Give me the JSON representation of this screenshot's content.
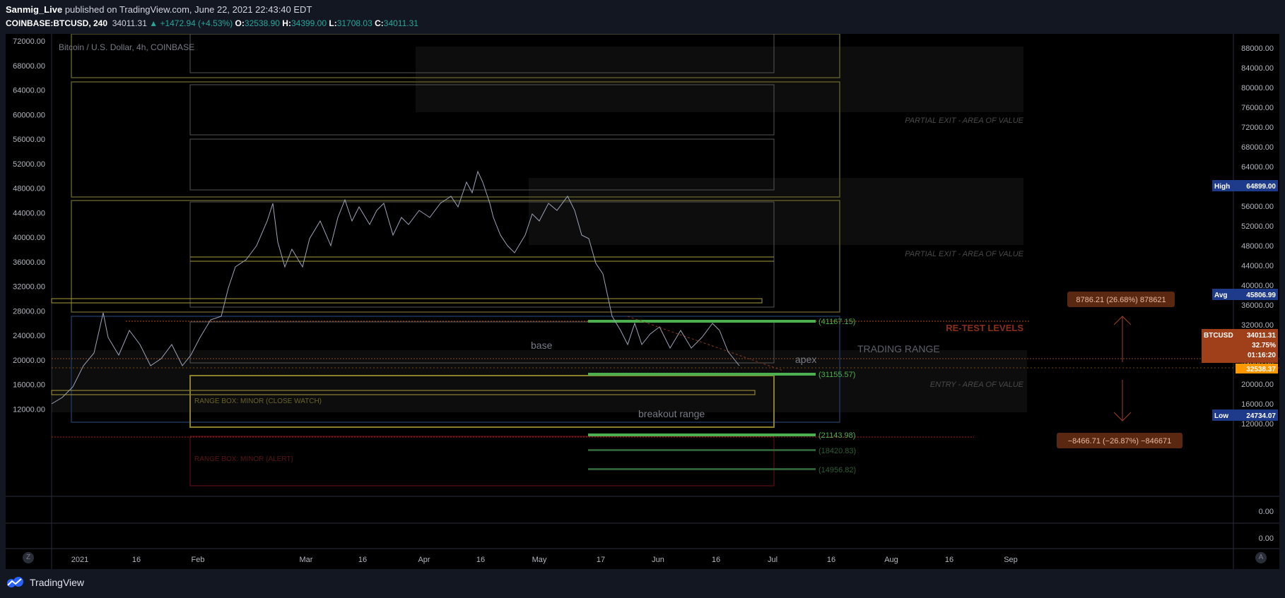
{
  "header": {
    "publisher": "Sanmig_Live",
    "published_text": "published on TradingView.com, June 22, 2021 22:43:40 EDT",
    "symbol": "COINBASE:BTCUSD, 240",
    "last": "34011.31",
    "change": "+1472.94 (+4.53%)",
    "o_label": "O:",
    "o": "32538.90",
    "h_label": "H:",
    "h": "34399.00",
    "l_label": "L:",
    "l": "31708.03",
    "c_label": "C:",
    "c": "34011.31"
  },
  "chart": {
    "title": "Bitcoin / U.S. Dollar, 4h, COINBASE",
    "left_axis": [
      "72000.00",
      "68000.00",
      "64000.00",
      "60000.00",
      "56000.00",
      "52000.00",
      "48000.00",
      "44000.00",
      "40000.00",
      "36000.00",
      "32000.00",
      "28000.00",
      "24000.00",
      "20000.00",
      "16000.00",
      "12000.00"
    ],
    "right_axis": [
      "88000.00",
      "84000.00",
      "80000.00",
      "76000.00",
      "72000.00",
      "68000.00",
      "64000.00",
      "60000.00",
      "56000.00",
      "52000.00",
      "48000.00",
      "44000.00",
      "40000.00",
      "36000.00",
      "32000.00",
      "28000.00",
      "24000.00",
      "20000.00",
      "16000.00",
      "12000.00"
    ],
    "sub_axis": [
      "0.00",
      "0.00"
    ],
    "x_axis": [
      "2021",
      "16",
      "Feb",
      "Mar",
      "16",
      "Apr",
      "16",
      "May",
      "17",
      "Jun",
      "16",
      "Jul",
      "16",
      "Aug",
      "16",
      "Sep"
    ],
    "annotations": {
      "partial_exit_1": "PARTIAL EXIT - AREA OF VALUE",
      "partial_exit_2": "PARTIAL EXIT - AREA OF VALUE",
      "retest": "RE-TEST LEVELS",
      "trading_range": "TRADING RANGE",
      "entry": "ENTRY - AREA OF VALUE",
      "base": "base",
      "apex": "apex",
      "breakout": "breakout range",
      "range_box_minor_watch": "RANGE BOX: MINOR  (CLOSE WATCH)",
      "range_box_minor_alert": "RANGE BOX: MINOR (ALERT)",
      "level_41167": "(41167.15)",
      "level_31155": "(31155.57)",
      "level_21143": "(21143.98)",
      "level_18420": "(18420.83)",
      "level_14956": "(14956.82)",
      "measure_up": "8786.21 (26.68%) 878621",
      "measure_down": "−8466.71 (−26.87%) −846671"
    },
    "badges": {
      "high_label": "High",
      "high_value": "64899.00",
      "avg_label": "Avg",
      "avg_value": "45806.99",
      "btc_label": "BTCUSD",
      "btc_value": "34011.31",
      "btc_pct": "32.75%",
      "btc_time": "01:16:20",
      "open_value": "32538.37",
      "low_label": "Low",
      "low_value": "24734.07"
    },
    "colors": {
      "green": "#4caf50",
      "orange": "#ff9800",
      "red": "#b71c1c",
      "navy": "#1e3a8a"
    }
  },
  "buttons": {
    "zoom_left": "Z",
    "auto_right": "A"
  },
  "footer": {
    "brand": "TradingView"
  }
}
